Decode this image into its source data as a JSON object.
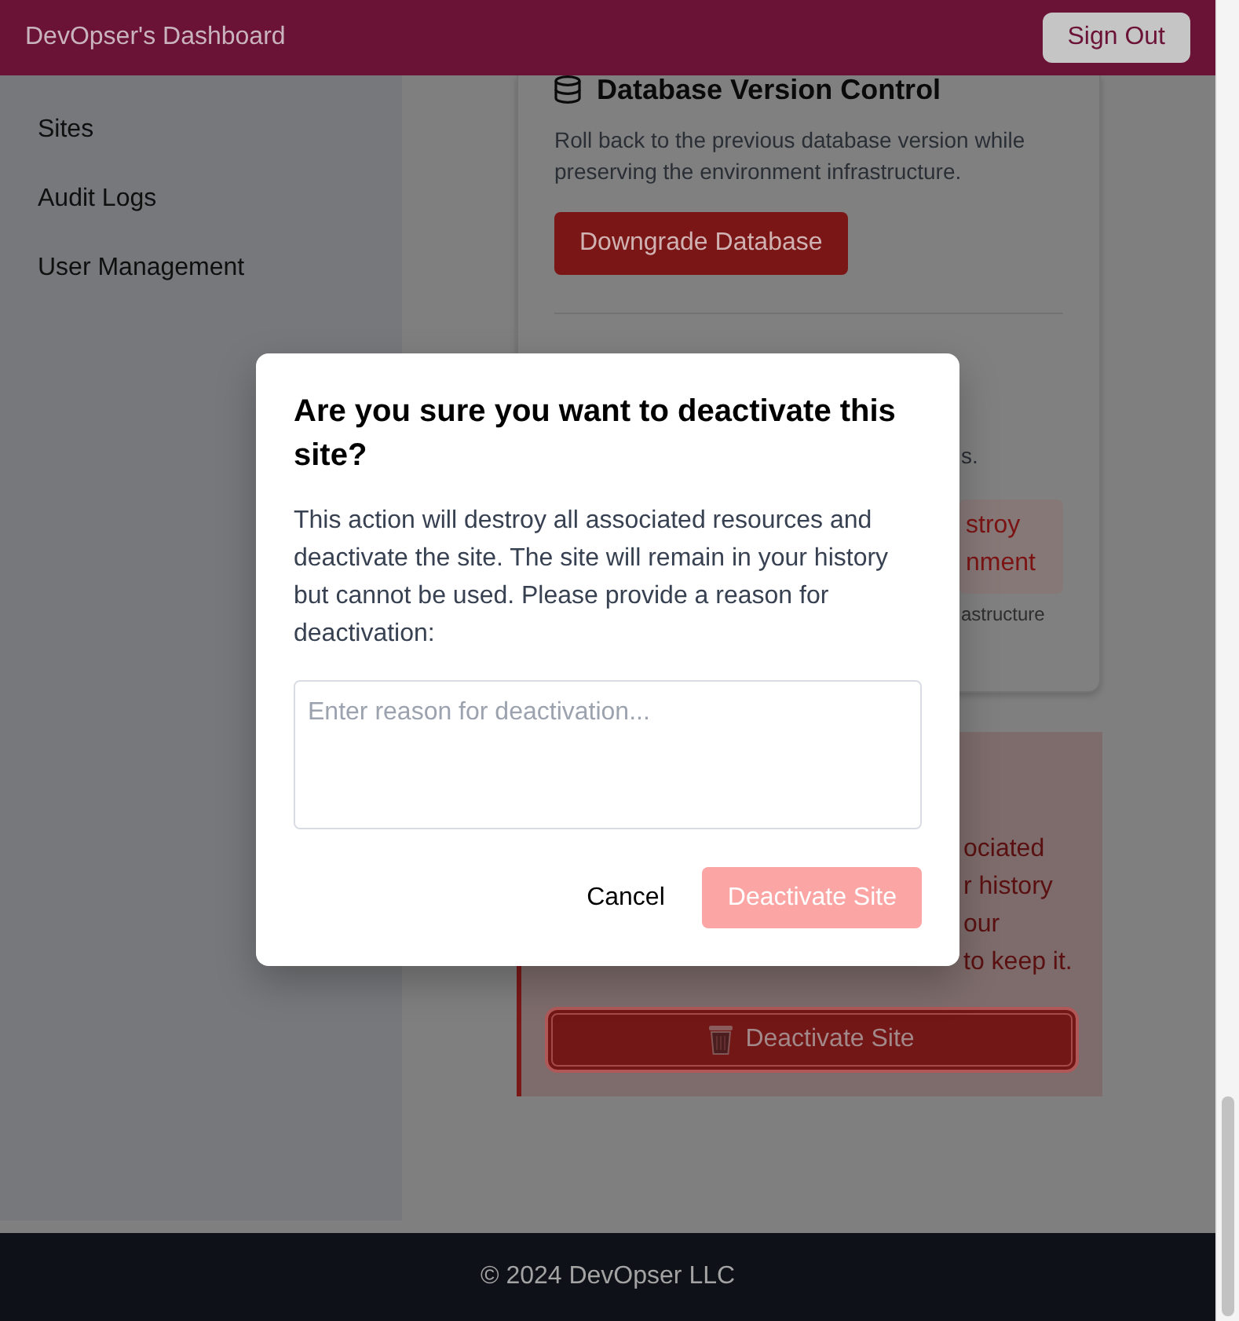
{
  "header": {
    "title": "DevOpser's Dashboard",
    "sign_out": "Sign Out"
  },
  "sidebar": {
    "items": [
      {
        "label": "Sites",
        "selected": false
      },
      {
        "label": "Audit Logs",
        "selected": false
      },
      {
        "label": "User Management",
        "selected": false
      }
    ]
  },
  "version_card": {
    "title": "Database Version Control",
    "description": "Roll back to the previous database version while preserving the environment infrastructure.",
    "button": "Downgrade Database",
    "description_end": "s.",
    "alert_lines": [
      "stroy",
      "nment"
    ],
    "note_end": "astructure"
  },
  "danger_card": {
    "text_lines": [
      "ociated",
      "r history",
      "our",
      "to keep it."
    ],
    "button": "Deactivate Site"
  },
  "modal": {
    "title": "Are you sure you want to deactivate this site?",
    "message": "This action will destroy all associated resources and deactivate the site. The site will remain in your history but cannot be used. Please provide a reason for deactivation:",
    "reason_field": {
      "placeholder": "Enter reason for deactivation..."
    },
    "cancel": "Cancel",
    "confirm": {
      "label": "Deactivate Site",
      "disabled": true
    }
  },
  "footer": {
    "text": "© 2024 DevOpser LLC"
  }
}
